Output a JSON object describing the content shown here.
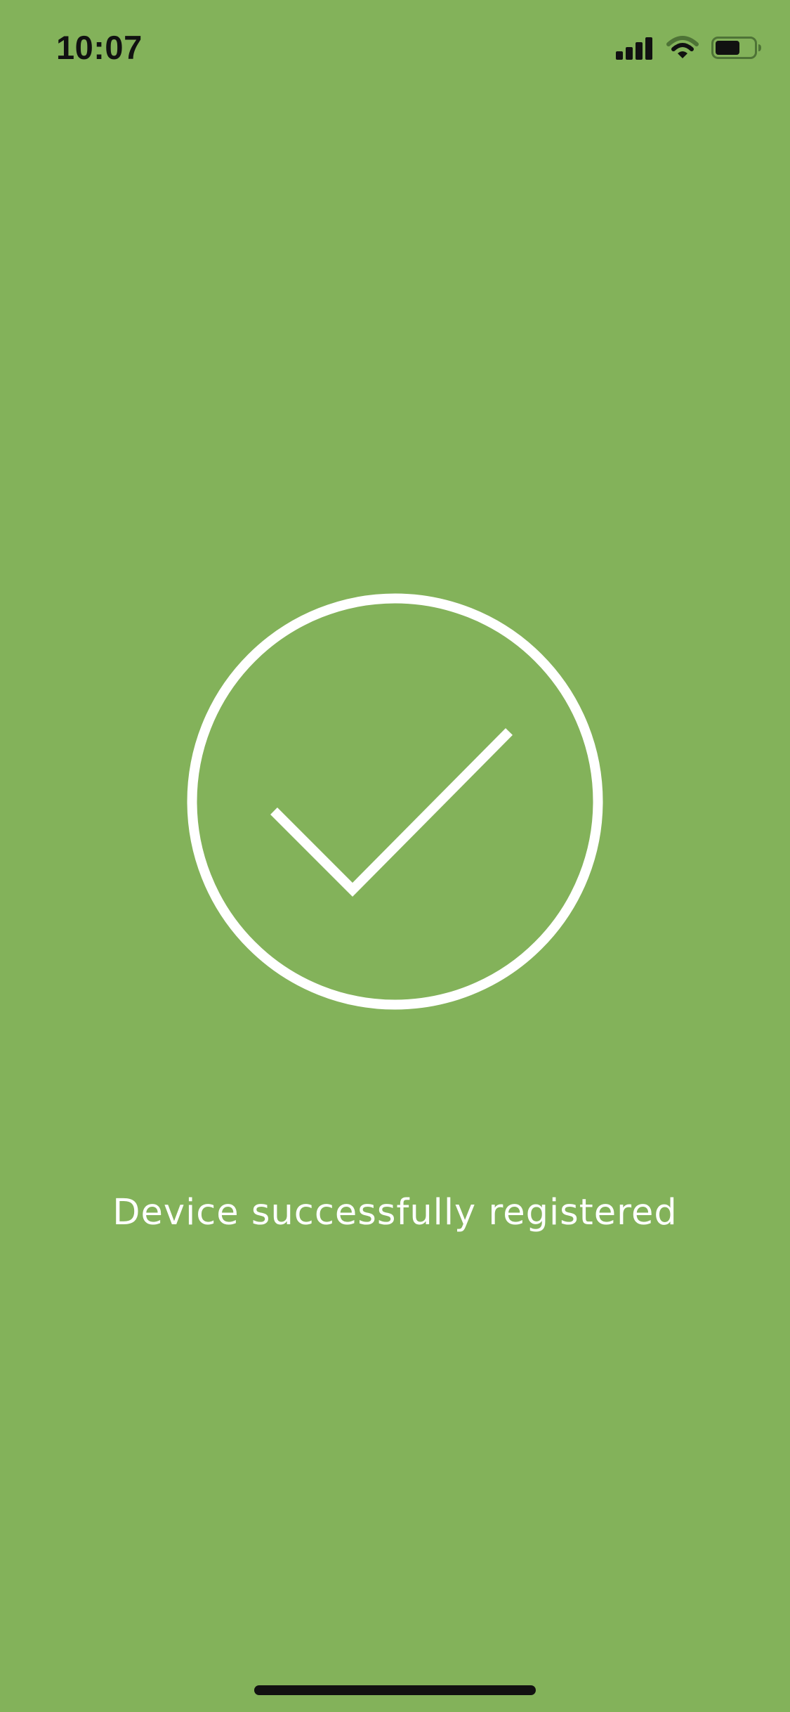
{
  "status_bar": {
    "time": "10:07",
    "icons": [
      "cellular-signal-icon",
      "wifi-icon",
      "battery-icon"
    ]
  },
  "success": {
    "icon": "checkmark-circle-icon",
    "message": "Device successfully registered"
  },
  "colors": {
    "background": "#83b25a",
    "foreground": "#ffffff",
    "status_text": "#111111"
  }
}
